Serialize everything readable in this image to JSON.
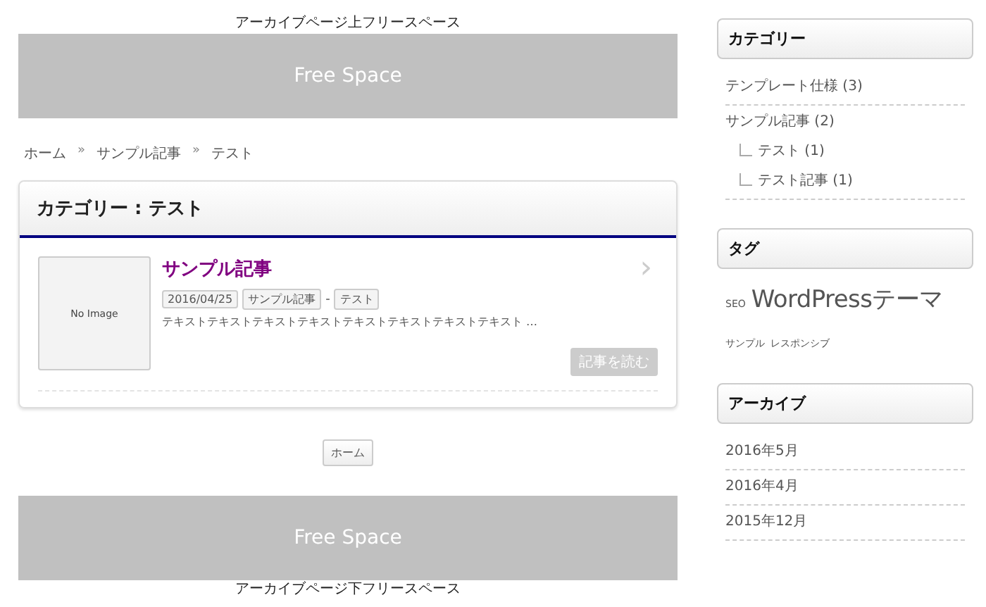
{
  "top_free_space": {
    "caption": "アーカイブページ上フリースペース",
    "label": "Free Space"
  },
  "breadcrumb": [
    "ホーム",
    "»",
    "サンプル記事",
    "»",
    "テスト"
  ],
  "archive": {
    "title": "カテゴリー : テスト",
    "posts": [
      {
        "thumbnail": "No Image",
        "title": "サンプル記事",
        "date": "2016/04/25",
        "categories": [
          "サンプル記事",
          "テスト"
        ],
        "separator": "-",
        "excerpt": "テキストテキストテキストテキストテキストテキストテキストテキスト …",
        "read_more": "記事を読む",
        "chevron": "›"
      }
    ]
  },
  "pagination": [
    "ホーム"
  ],
  "bottom_free_space": {
    "caption": "アーカイブページ下フリースペース",
    "label": "Free Space"
  },
  "sidebar": {
    "categories": {
      "title": "カテゴリー",
      "items": [
        {
          "label": "テンプレート仕様 (3)"
        },
        {
          "label": "サンプル記事 (2)",
          "children": [
            {
              "label": "テスト (1)"
            },
            {
              "label": "テスト記事 (1)"
            }
          ]
        }
      ]
    },
    "tags": {
      "title": "タグ",
      "items": [
        {
          "label": "SEO",
          "kind": "small"
        },
        {
          "label": "WordPressテーマ",
          "kind": "large"
        },
        {
          "label": "サンプル",
          "kind": "small"
        },
        {
          "label": "レスポンシブ",
          "kind": "small"
        }
      ]
    },
    "archives": {
      "title": "アーカイブ",
      "items": [
        "2016年5月",
        "2016年4月",
        "2015年12月"
      ]
    }
  }
}
